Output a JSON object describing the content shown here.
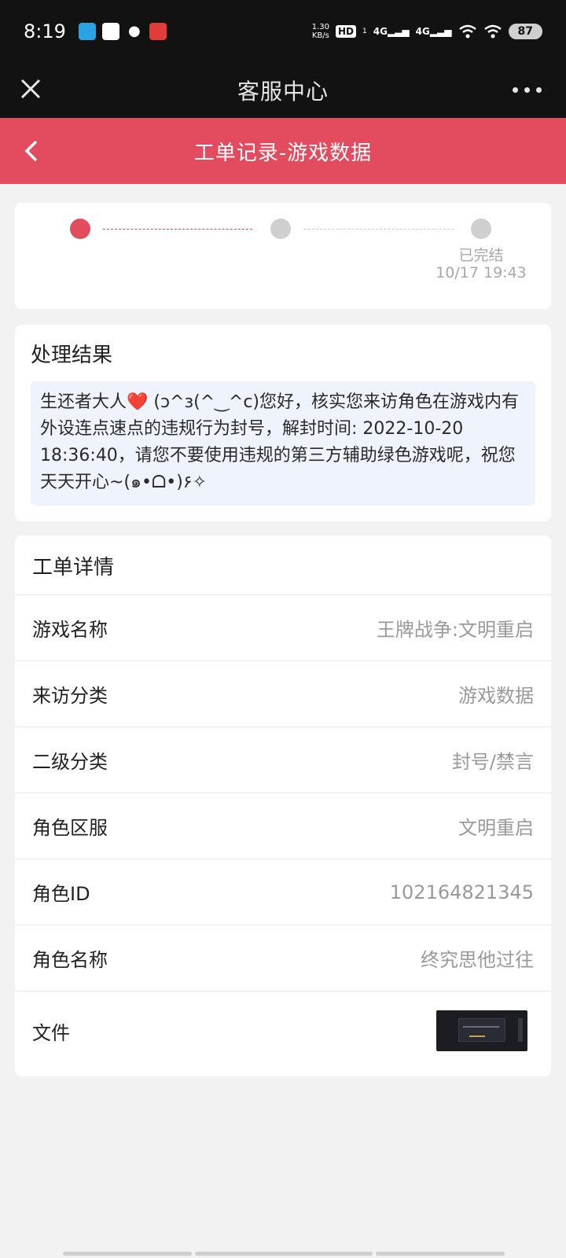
{
  "status": {
    "time": "8:19",
    "netspeed_value": "1.30",
    "netspeed_unit": "KB/s",
    "hd": "HD",
    "hd_sub": "1",
    "sig1": "4G",
    "sig2": "4G",
    "battery": "87"
  },
  "topbar": {
    "title": "客服中心"
  },
  "header": {
    "title": "工单记录-游戏数据"
  },
  "progress": {
    "final_step_label": "已完结",
    "final_step_time": "10/17 19:43"
  },
  "result": {
    "title": "处理结果",
    "text": "生还者大人❤️ (ɔ^з(^‿^c)您好，核实您来访角色在游戏内有外设连点速点的违规行为封号，解封时间: 2022-10-20 18:36:40，请您不要使用违规的第三方辅助绿色游戏呢，祝您天天开心~(๑•ᗝ•)۶✧"
  },
  "details": {
    "title": "工单详情",
    "rows": [
      {
        "label": "游戏名称",
        "value": "王牌战争:文明重启"
      },
      {
        "label": "来访分类",
        "value": "游戏数据"
      },
      {
        "label": "二级分类",
        "value": "封号/禁言"
      },
      {
        "label": "角色区服",
        "value": "文明重启"
      },
      {
        "label": "角色ID",
        "value": "102164821345"
      },
      {
        "label": "角色名称",
        "value": "终究思他过往"
      }
    ],
    "file_label": "文件"
  },
  "colors": {
    "accent": "#e34b5f",
    "dark_bar": "#121212",
    "result_bg": "#eef3fc"
  }
}
